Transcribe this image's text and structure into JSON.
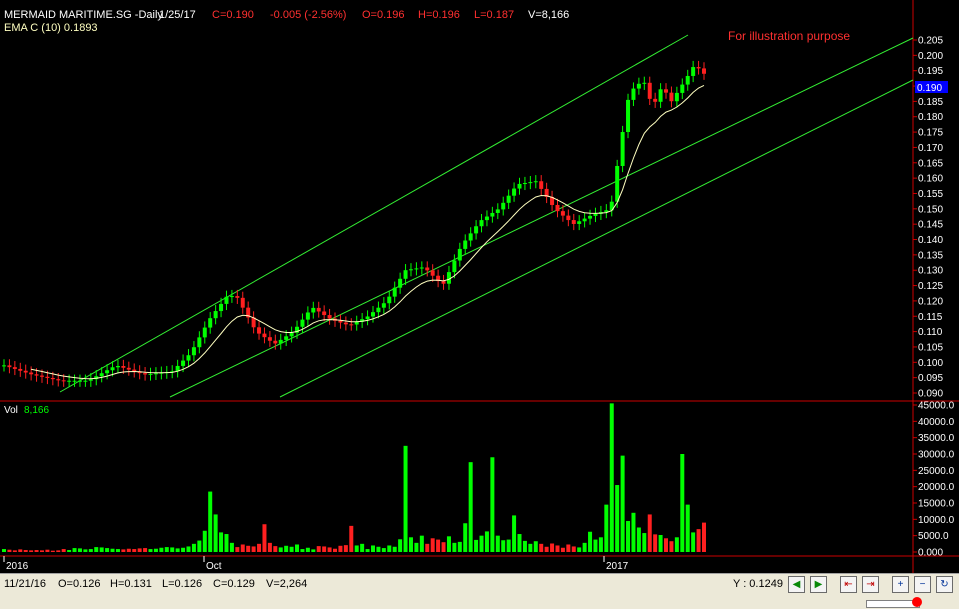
{
  "header": {
    "symbol": "MERMAID MARITIME.SG -Daily",
    "date": "1/25/17",
    "close": "C=0.190",
    "change": "-0.005 (-2.56%)",
    "open": "O=0.196",
    "high": "H=0.196",
    "low": "L=0.187",
    "volume": "V=8,166",
    "ema": "EMA C (10) 0.1893"
  },
  "annotation": "For illustration purpose",
  "vol_label": "Vol",
  "vol_value": "8,166",
  "last_price_tag": "0.190",
  "colors": {
    "background": "#000000",
    "up": "#00ff00",
    "down": "#ff2020",
    "ema": "#ffffc0",
    "channel": "#33ee33",
    "separator": "#cc0000"
  },
  "status": {
    "date": "11/21/16",
    "open": "O=0.126",
    "high": "H=0.131",
    "low": "L=0.126",
    "close": "C=0.129",
    "volume": "V=2,264",
    "cursor_y": "Y : 0.1249"
  },
  "chart_data": [
    {
      "type": "candlestick",
      "title": "MERMAID MARITIME.SG -Daily",
      "series": [
        {
          "name": "Price"
        },
        {
          "name": "EMA C (10)"
        }
      ],
      "x_tick_labels": [
        "2016",
        "Oct",
        "2017"
      ],
      "y_range": [
        0.09,
        0.205
      ],
      "y_ticks": [
        "0.205",
        "0.200",
        "0.195",
        "0.190",
        "0.185",
        "0.180",
        "0.175",
        "0.170",
        "0.165",
        "0.160",
        "0.155",
        "0.150",
        "0.145",
        "0.140",
        "0.135",
        "0.130",
        "0.125",
        "0.120",
        "0.115",
        "0.110",
        "0.105",
        "0.100",
        "0.095",
        "0.090"
      ],
      "channel_lines": "three parallel ascending trend lines",
      "grid": false
    },
    {
      "type": "bar",
      "title": "Vol",
      "y_range": [
        0,
        45000
      ],
      "y_ticks": [
        "45000.0",
        "40000.0",
        "35000.0",
        "30000.0",
        "25000.0",
        "20000.0",
        "15000.0",
        "10000.0",
        "5000.0",
        "0.000"
      ],
      "volumes": [
        900,
        700,
        500,
        800,
        600,
        500,
        600,
        500,
        700,
        400,
        500,
        900,
        600,
        1200,
        1100,
        800,
        900,
        1500,
        1400,
        1200,
        1000,
        900,
        800,
        1000,
        900,
        1100,
        1200,
        900,
        1000,
        1300,
        1500,
        1400,
        1100,
        1300,
        1700,
        2500,
        3500,
        6500,
        18500,
        11500,
        6000,
        5500,
        2800,
        1500,
        2300,
        1900,
        1700,
        2500,
        8500,
        2800,
        1800,
        1400,
        1900,
        1600,
        2300,
        900,
        1300,
        800,
        1800,
        1700,
        1400,
        1000,
        1900,
        2100,
        8000,
        2000,
        2500,
        900,
        2000,
        1600,
        1200,
        2000,
        1600,
        3900,
        32500,
        4500,
        2800,
        5000,
        2500,
        4200,
        3800,
        3000,
        4800,
        2800,
        3100,
        8800,
        27500,
        3700,
        5000,
        6300,
        29000,
        5000,
        3600,
        3800,
        11200,
        5500,
        3400,
        2500,
        3300,
        2500,
        1600,
        2600,
        2000,
        1300,
        2300,
        1700,
        1400,
        2800,
        6200,
        3800,
        4500,
        14500,
        45500,
        20500,
        29500,
        9500,
        12000,
        7500,
        5800,
        11500,
        5400,
        5200,
        4200,
        3300,
        4500,
        30000,
        14500,
        6000,
        7000,
        9000
      ],
      "volume_colors": "green for up days, red for down days"
    }
  ]
}
